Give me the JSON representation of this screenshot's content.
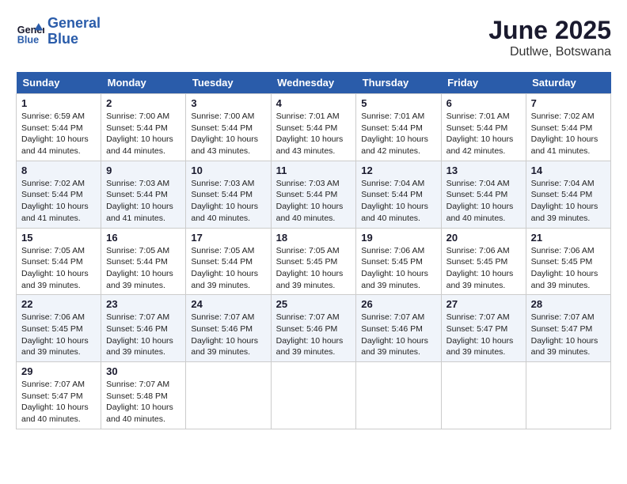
{
  "logo": {
    "text_general": "General",
    "text_blue": "Blue"
  },
  "title": "June 2025",
  "location": "Dutlwe, Botswana",
  "days_of_week": [
    "Sunday",
    "Monday",
    "Tuesday",
    "Wednesday",
    "Thursday",
    "Friday",
    "Saturday"
  ],
  "weeks": [
    [
      {
        "day": "1",
        "sunrise": "6:59 AM",
        "sunset": "5:44 PM",
        "daylight": "10 hours and 44 minutes."
      },
      {
        "day": "2",
        "sunrise": "7:00 AM",
        "sunset": "5:44 PM",
        "daylight": "10 hours and 44 minutes."
      },
      {
        "day": "3",
        "sunrise": "7:00 AM",
        "sunset": "5:44 PM",
        "daylight": "10 hours and 43 minutes."
      },
      {
        "day": "4",
        "sunrise": "7:01 AM",
        "sunset": "5:44 PM",
        "daylight": "10 hours and 43 minutes."
      },
      {
        "day": "5",
        "sunrise": "7:01 AM",
        "sunset": "5:44 PM",
        "daylight": "10 hours and 42 minutes."
      },
      {
        "day": "6",
        "sunrise": "7:01 AM",
        "sunset": "5:44 PM",
        "daylight": "10 hours and 42 minutes."
      },
      {
        "day": "7",
        "sunrise": "7:02 AM",
        "sunset": "5:44 PM",
        "daylight": "10 hours and 41 minutes."
      }
    ],
    [
      {
        "day": "8",
        "sunrise": "7:02 AM",
        "sunset": "5:44 PM",
        "daylight": "10 hours and 41 minutes."
      },
      {
        "day": "9",
        "sunrise": "7:03 AM",
        "sunset": "5:44 PM",
        "daylight": "10 hours and 41 minutes."
      },
      {
        "day": "10",
        "sunrise": "7:03 AM",
        "sunset": "5:44 PM",
        "daylight": "10 hours and 40 minutes."
      },
      {
        "day": "11",
        "sunrise": "7:03 AM",
        "sunset": "5:44 PM",
        "daylight": "10 hours and 40 minutes."
      },
      {
        "day": "12",
        "sunrise": "7:04 AM",
        "sunset": "5:44 PM",
        "daylight": "10 hours and 40 minutes."
      },
      {
        "day": "13",
        "sunrise": "7:04 AM",
        "sunset": "5:44 PM",
        "daylight": "10 hours and 40 minutes."
      },
      {
        "day": "14",
        "sunrise": "7:04 AM",
        "sunset": "5:44 PM",
        "daylight": "10 hours and 39 minutes."
      }
    ],
    [
      {
        "day": "15",
        "sunrise": "7:05 AM",
        "sunset": "5:44 PM",
        "daylight": "10 hours and 39 minutes."
      },
      {
        "day": "16",
        "sunrise": "7:05 AM",
        "sunset": "5:44 PM",
        "daylight": "10 hours and 39 minutes."
      },
      {
        "day": "17",
        "sunrise": "7:05 AM",
        "sunset": "5:44 PM",
        "daylight": "10 hours and 39 minutes."
      },
      {
        "day": "18",
        "sunrise": "7:05 AM",
        "sunset": "5:45 PM",
        "daylight": "10 hours and 39 minutes."
      },
      {
        "day": "19",
        "sunrise": "7:06 AM",
        "sunset": "5:45 PM",
        "daylight": "10 hours and 39 minutes."
      },
      {
        "day": "20",
        "sunrise": "7:06 AM",
        "sunset": "5:45 PM",
        "daylight": "10 hours and 39 minutes."
      },
      {
        "day": "21",
        "sunrise": "7:06 AM",
        "sunset": "5:45 PM",
        "daylight": "10 hours and 39 minutes."
      }
    ],
    [
      {
        "day": "22",
        "sunrise": "7:06 AM",
        "sunset": "5:45 PM",
        "daylight": "10 hours and 39 minutes."
      },
      {
        "day": "23",
        "sunrise": "7:07 AM",
        "sunset": "5:46 PM",
        "daylight": "10 hours and 39 minutes."
      },
      {
        "day": "24",
        "sunrise": "7:07 AM",
        "sunset": "5:46 PM",
        "daylight": "10 hours and 39 minutes."
      },
      {
        "day": "25",
        "sunrise": "7:07 AM",
        "sunset": "5:46 PM",
        "daylight": "10 hours and 39 minutes."
      },
      {
        "day": "26",
        "sunrise": "7:07 AM",
        "sunset": "5:46 PM",
        "daylight": "10 hours and 39 minutes."
      },
      {
        "day": "27",
        "sunrise": "7:07 AM",
        "sunset": "5:47 PM",
        "daylight": "10 hours and 39 minutes."
      },
      {
        "day": "28",
        "sunrise": "7:07 AM",
        "sunset": "5:47 PM",
        "daylight": "10 hours and 39 minutes."
      }
    ],
    [
      {
        "day": "29",
        "sunrise": "7:07 AM",
        "sunset": "5:47 PM",
        "daylight": "10 hours and 40 minutes."
      },
      {
        "day": "30",
        "sunrise": "7:07 AM",
        "sunset": "5:48 PM",
        "daylight": "10 hours and 40 minutes."
      },
      null,
      null,
      null,
      null,
      null
    ]
  ],
  "labels": {
    "sunrise_prefix": "Sunrise: ",
    "sunset_prefix": "Sunset: ",
    "daylight_prefix": "Daylight: "
  }
}
